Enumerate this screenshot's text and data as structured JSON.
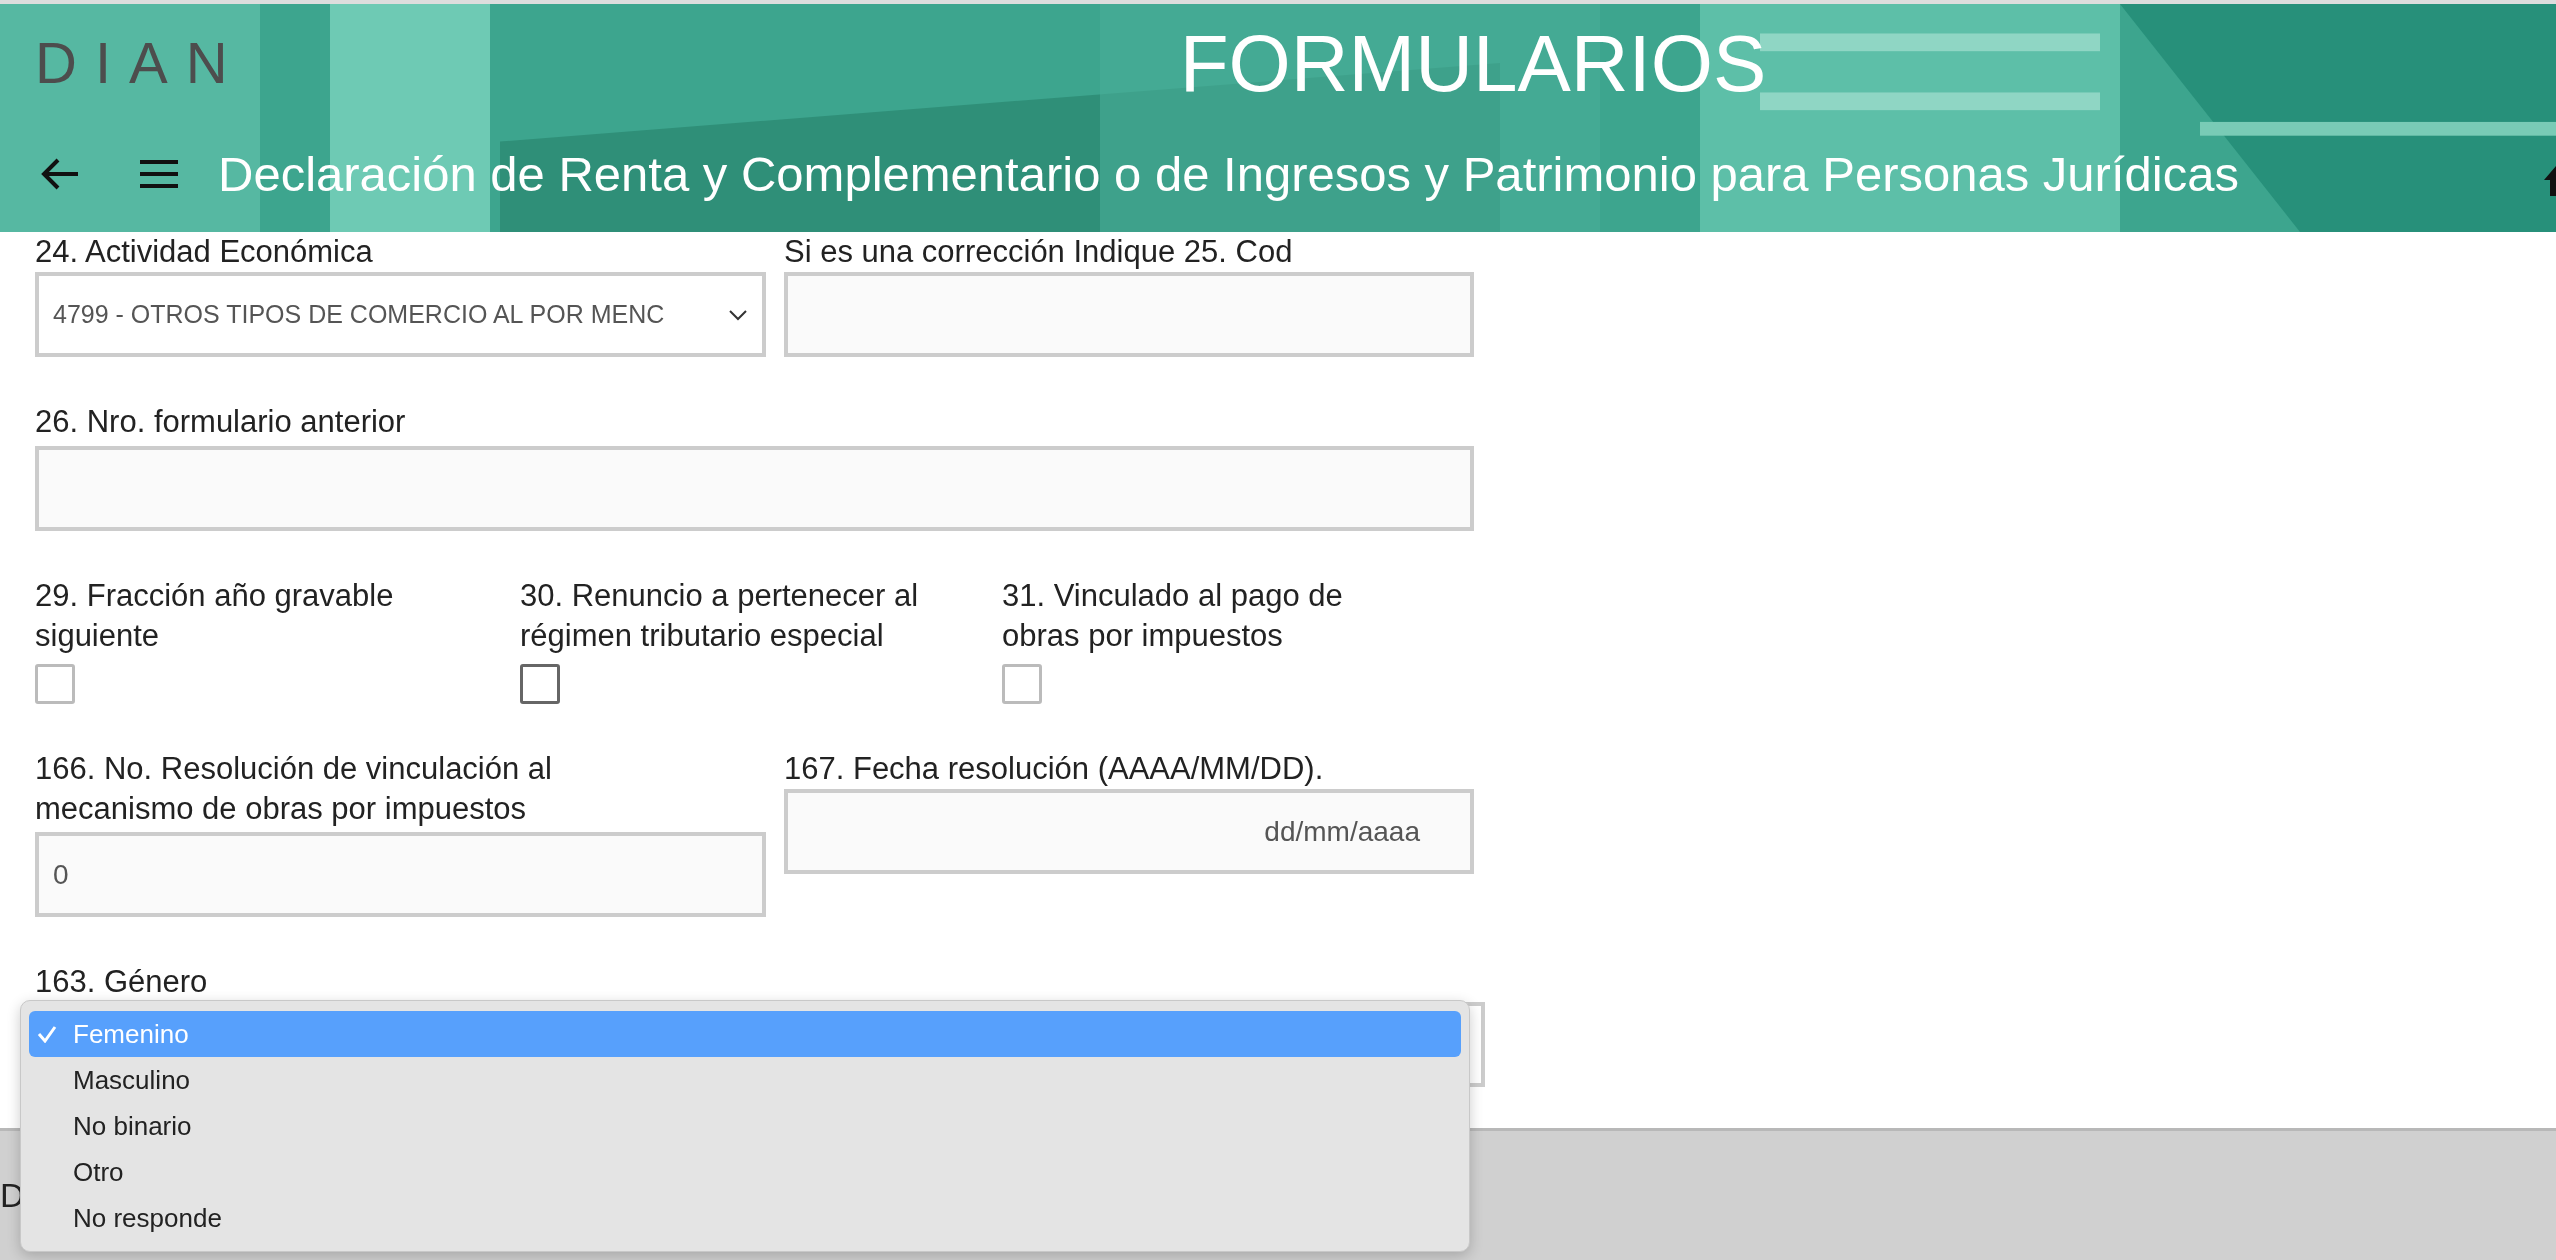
{
  "header": {
    "logo": "DIAN",
    "title": "FORMULARIOS",
    "subtitle": "Declaración de Renta y Complementario o de Ingresos y Patrimonio para Personas Jurídicas"
  },
  "fields": {
    "activity": {
      "label": "24. Actividad Económica",
      "value": "4799 - OTROS TIPOS DE COMERCIO AL POR MENC"
    },
    "correction": {
      "label": "Si es una corrección Indique 25. Cod"
    },
    "previous": {
      "label": "26. Nro. formulario anterior"
    },
    "checkboxes": [
      {
        "kind": "plain",
        "label": "29. Fracción año gravable siguiente",
        "checked": false
      },
      {
        "kind": "focused",
        "label": "30. Renuncio a pertenecer al régimen tributario especial",
        "checked": false
      },
      {
        "kind": "plain",
        "label": "31. Vinculado al pago de obras por impuestos",
        "checked": false
      }
    ],
    "resolution": {
      "label": "166. No. Resolución de vinculación al mecanismo de obras por impuestos",
      "value": "0"
    },
    "date": {
      "label": "167. Fecha resolución (AAAA/MM/DD).",
      "placeholder": "dd/mm/aaaa"
    },
    "gender": {
      "label": "163. Género",
      "options": [
        {
          "label": "Femenino",
          "selected": true
        },
        {
          "label": "Masculino",
          "selected": false
        },
        {
          "label": "No binario",
          "selected": false
        },
        {
          "label": "Otro",
          "selected": false
        },
        {
          "label": "No responde",
          "selected": false
        }
      ]
    }
  },
  "footer": {
    "text": "D"
  }
}
